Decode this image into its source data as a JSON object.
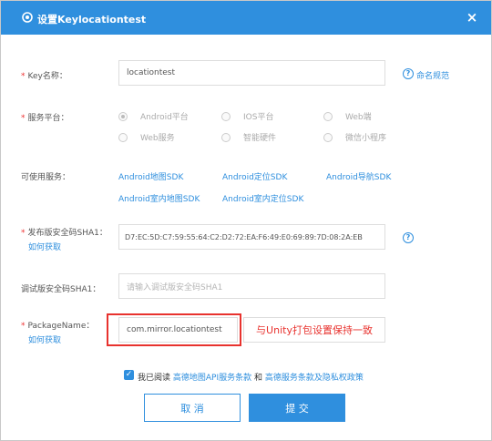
{
  "dialog": {
    "title": "设置Keylocationtest",
    "close_label": "×",
    "title_icon": "gear-icon",
    "accent_color": "#2f8fde"
  },
  "key_name": {
    "label": "Key名称：",
    "value": "locationtest",
    "help_link": "命名规范"
  },
  "platform": {
    "label": "服务平台：",
    "options": [
      "Android平台",
      "IOS平台",
      "Web端",
      "Web服务",
      "智能硬件",
      "微信小程序"
    ],
    "selected": "Android平台"
  },
  "services": {
    "label": "可使用服务：",
    "items": [
      "Android地图SDK",
      "Android定位SDK",
      "Android导航SDK",
      "Android室内地图SDK",
      "Android室内定位SDK"
    ]
  },
  "release_sha1": {
    "label": "发布版安全码SHA1：",
    "sublink": "如何获取",
    "value": "D7:EC:5D:C7:59:55:64:C2:D2:72:EA:F6:49:E0:69:89:7D:08:2A:EB",
    "help_icon": "?"
  },
  "debug_sha1": {
    "label": "调试版安全码SHA1：",
    "placeholder": "请输入调试版安全码SHA1"
  },
  "package_name": {
    "label": "PackageName：",
    "sublink": "如何获取",
    "value": "com.mirror.locationtest",
    "annotation": "与Unity打包设置保持一致"
  },
  "agreement": {
    "prefix": "我已阅读",
    "link1": "高德地图API服务条款",
    "middle": "和",
    "link2": "高德服务条款及隐私权政策",
    "checked": true
  },
  "buttons": {
    "cancel": "取 消",
    "submit": "提 交"
  }
}
